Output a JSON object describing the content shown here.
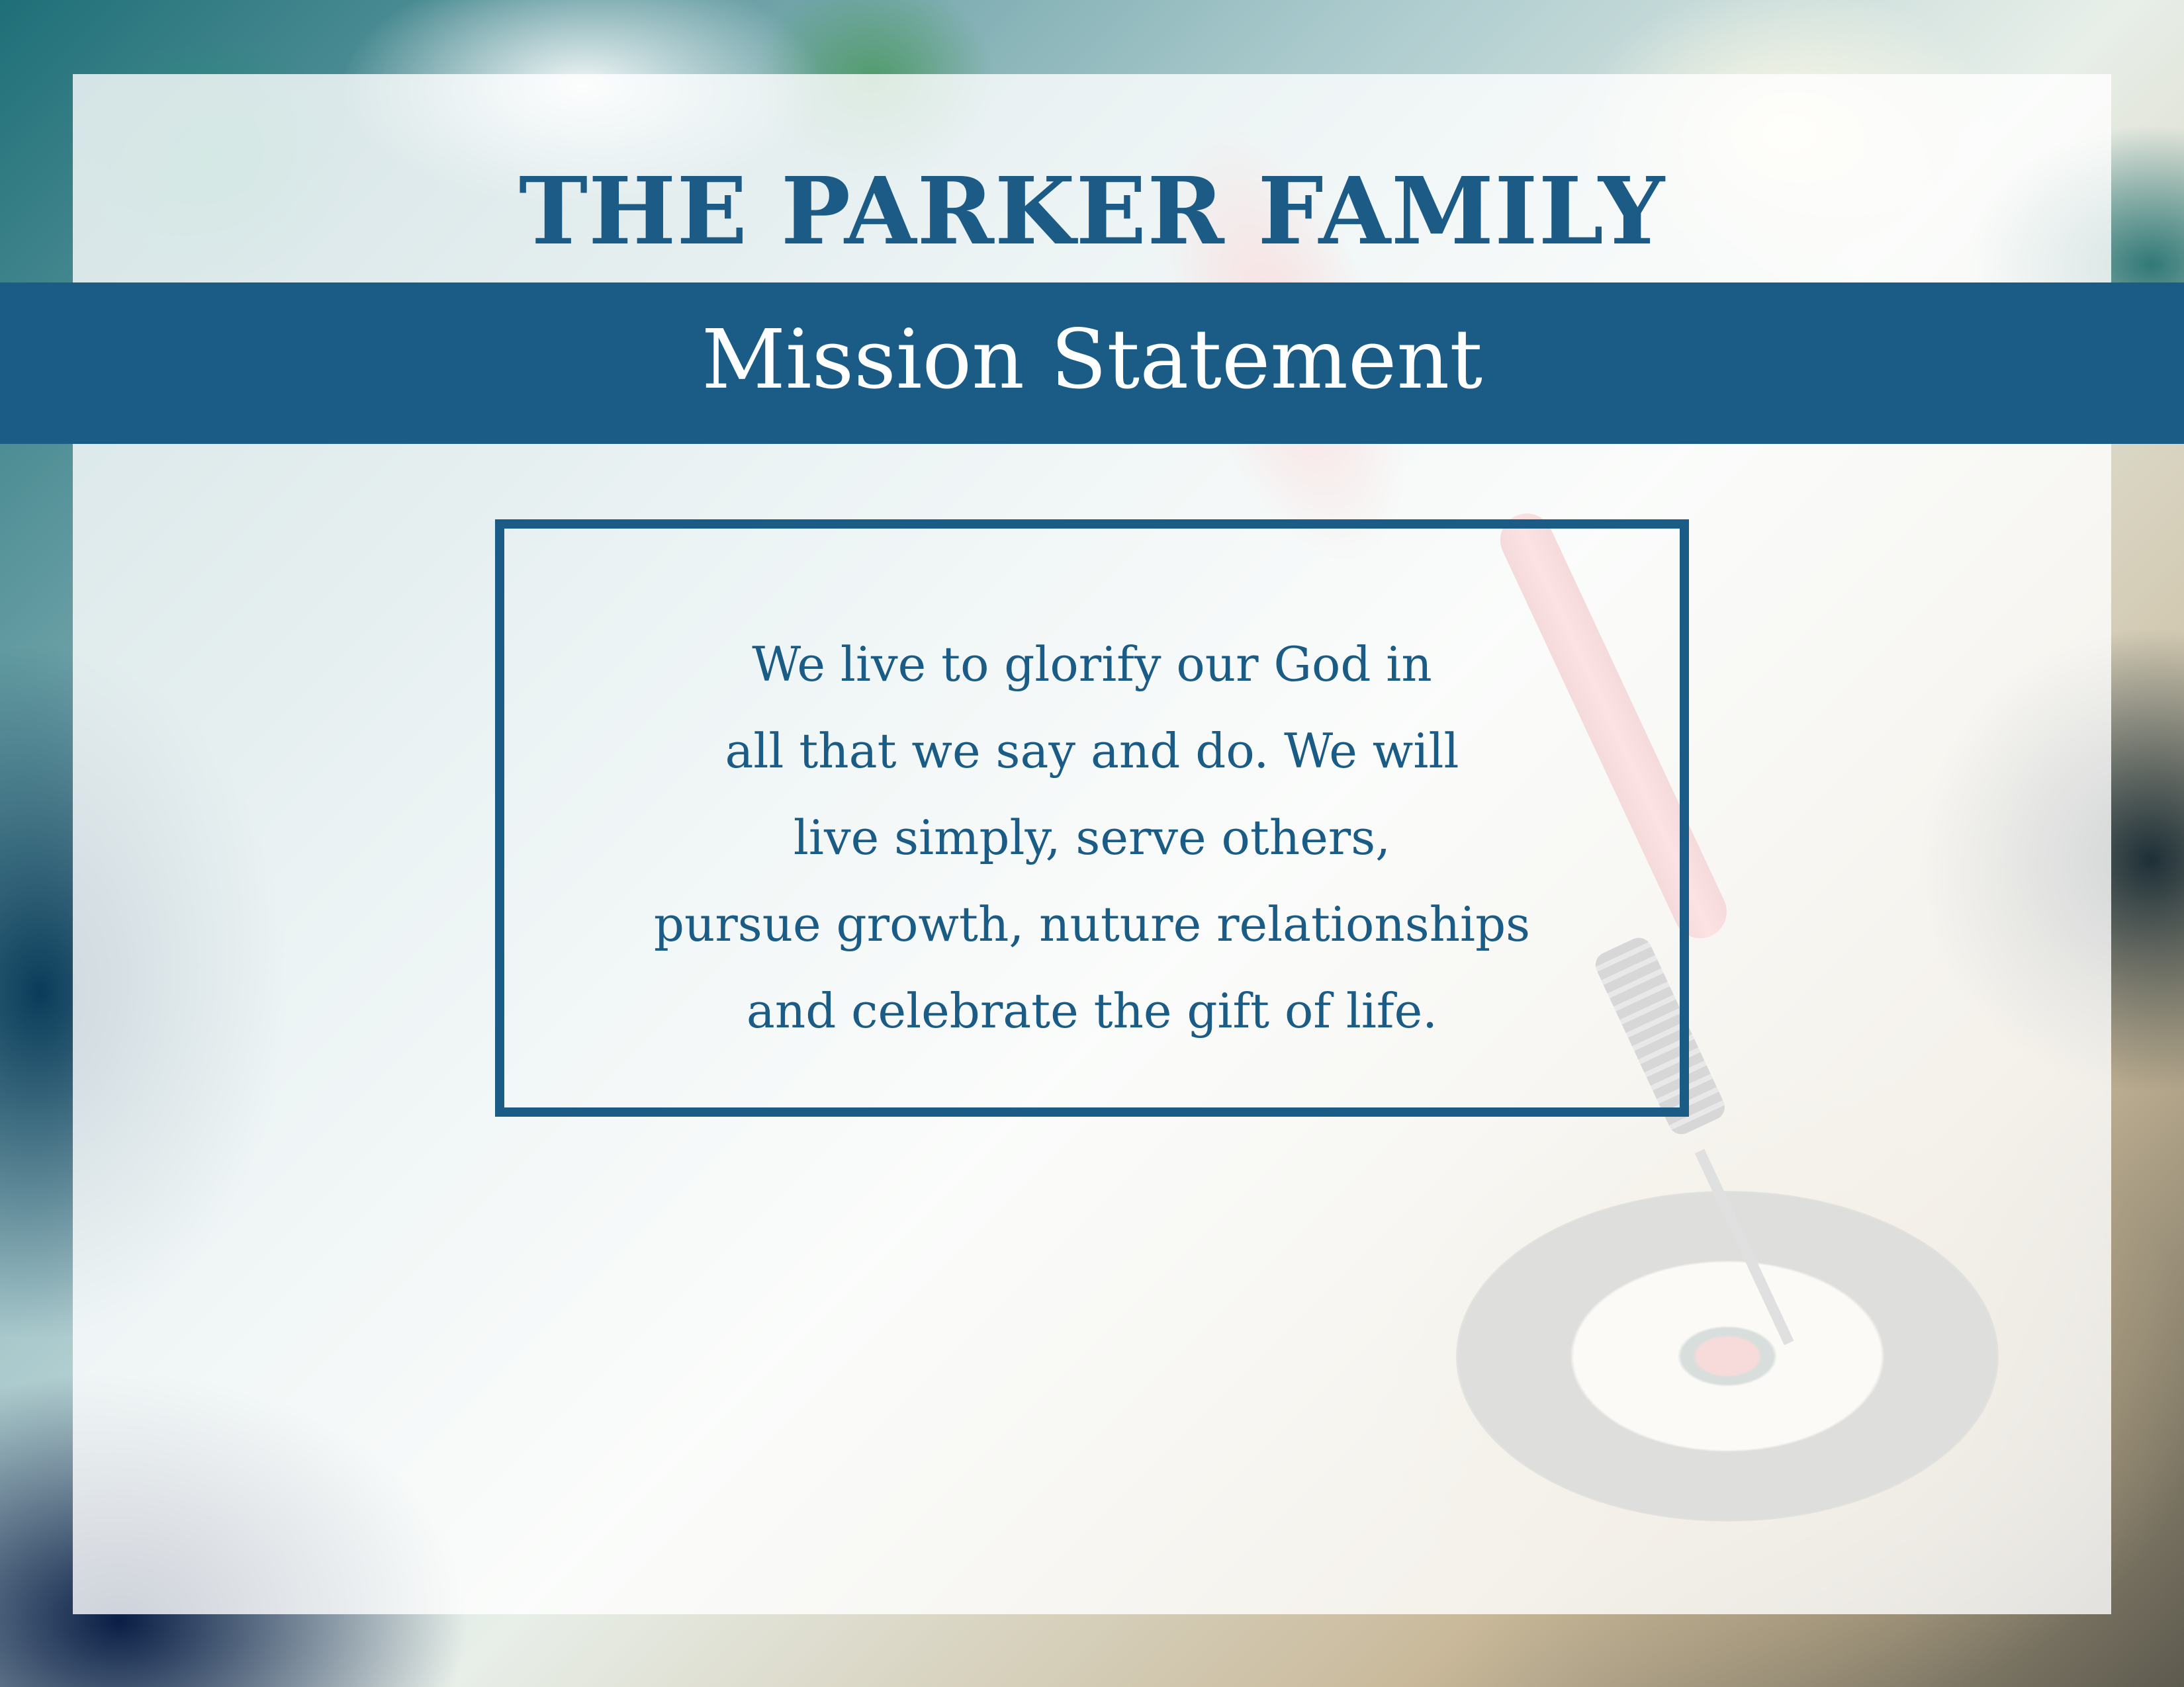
{
  "document": {
    "title": "THE PARKER FAMILY",
    "subtitle": "Mission Statement",
    "statement_lines": [
      "We live to glorify our God in",
      "all that we say and do. We will",
      "live simply, serve others,",
      "pursue growth, nuture relationships",
      "and celebrate the gift of life."
    ]
  },
  "colors": {
    "accent": "#1a5c85",
    "banner_text": "#ffffff",
    "panel_overlay": "#ffffff"
  },
  "background": {
    "icon": "dartboard-photo"
  }
}
